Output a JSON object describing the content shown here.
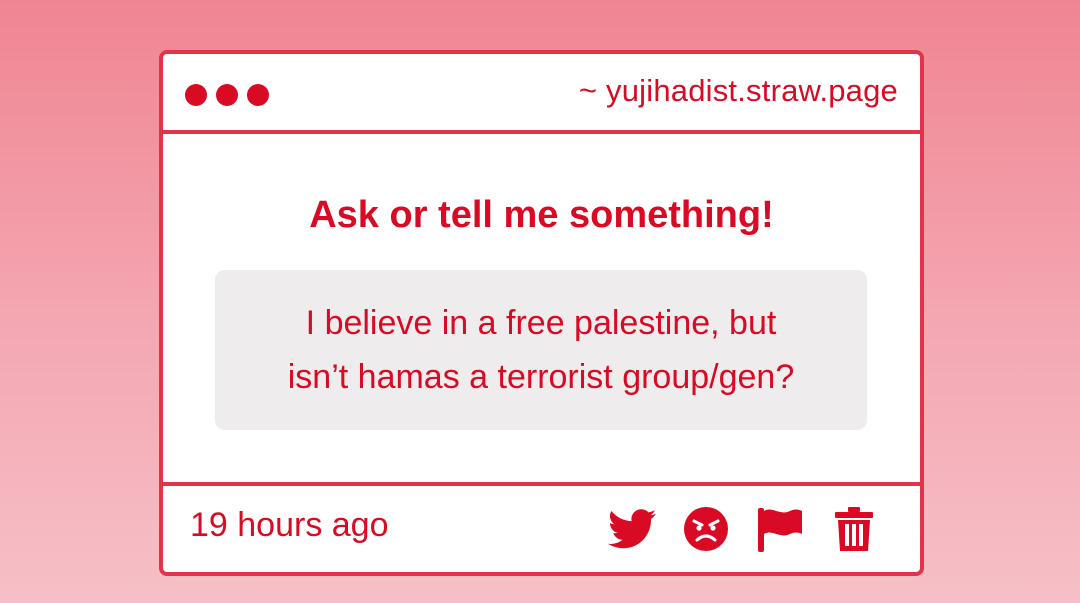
{
  "window": {
    "url": "~ yujihadist.straw.page"
  },
  "main": {
    "heading": "Ask or tell me something!",
    "message_line1": "I believe in a free palestine, but",
    "message_line2": "isn’t hamas a terrorist group/gen?"
  },
  "footer": {
    "timestamp": "19 hours ago",
    "actions": [
      "twitter-icon",
      "angry-face-icon",
      "flag-icon",
      "trash-icon"
    ]
  },
  "colors": {
    "accent": "#d90a24",
    "border": "#e0344a",
    "message_bg": "#eeeced"
  }
}
